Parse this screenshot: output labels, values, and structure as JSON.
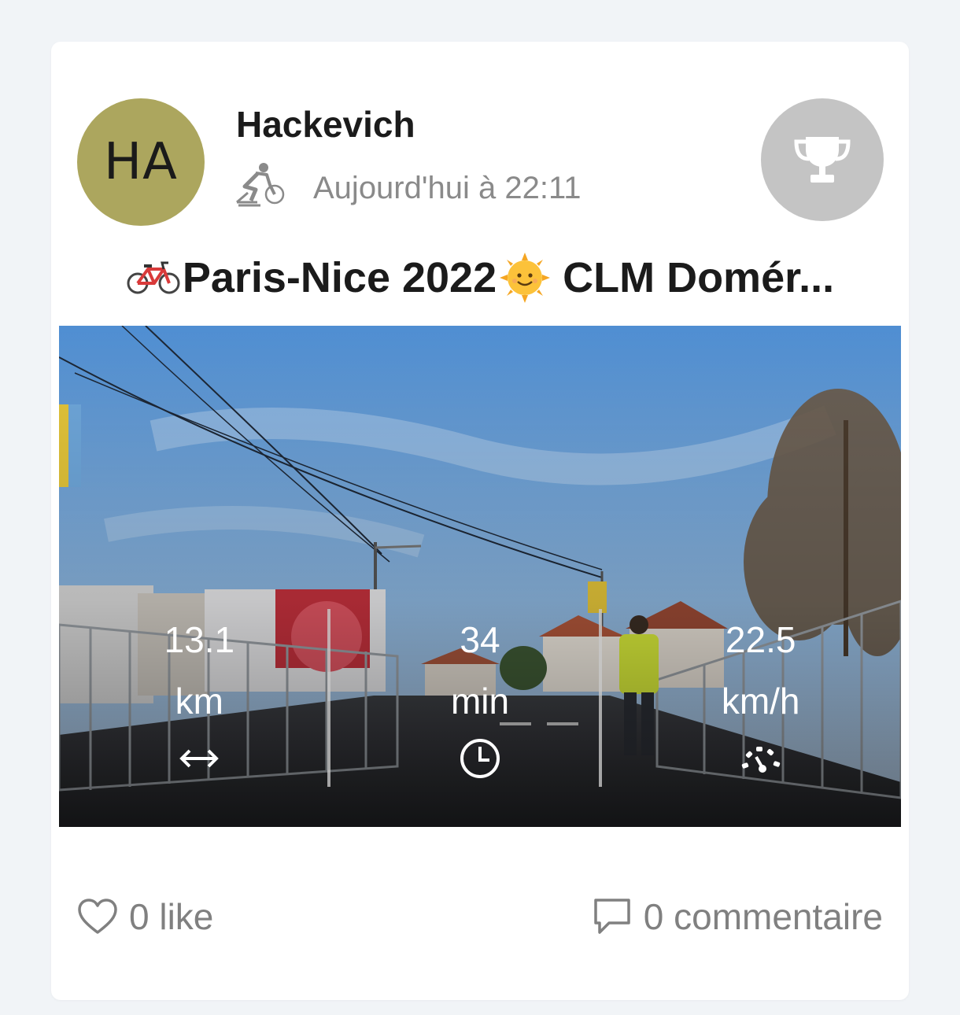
{
  "post": {
    "avatar_initials": "HA",
    "avatar_color": "#aca65e",
    "username": "Hackevich",
    "activity_icon": "cyclist-icon",
    "timestamp": "Aujourd'hui à 22:11",
    "title_prefix_emoji": "bicycle-emoji",
    "title_part1": "Paris-Nice 2022",
    "title_sun_emoji": "sun-with-face-emoji",
    "title_part2": "CLM Domér..."
  },
  "stats": [
    {
      "value": "13.1",
      "unit": "km",
      "icon": "distance-arrows-icon"
    },
    {
      "value": "34",
      "unit": "min",
      "icon": "clock-icon"
    },
    {
      "value": "22.5",
      "unit": "km/h",
      "icon": "speedometer-icon"
    }
  ],
  "footer": {
    "like_label": "0 like",
    "comment_label": "0 commentaire"
  }
}
